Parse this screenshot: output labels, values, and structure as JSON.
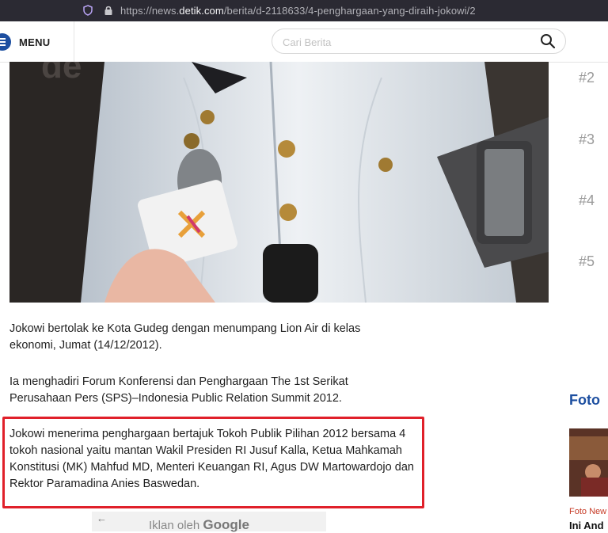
{
  "browser": {
    "url_prefix": "https://news.",
    "url_domain": "detik.com",
    "url_path": "/berita/d-2118633/4-penghargaan-yang-diraih-jokowi/2"
  },
  "header": {
    "menu_label": "MENU",
    "search_placeholder": "Cari Berita"
  },
  "article": {
    "paragraphs": [
      "Jokowi bertolak ke Kota Gudeg dengan menumpang Lion Air di kelas ekonomi, Jumat (14/12/2012).",
      "Ia menghadiri Forum Konferensi dan Penghargaan The 1st Serikat Perusahaan Pers (SPS)–Indonesia Public Relation Summit 2012.",
      "Jokowi menerima penghargaan bertajuk Tokoh Publik Pilihan 2012 bersama 4 tokoh nasional yaitu mantan Wakil Presiden RI Jusuf Kalla, Ketua Mahkamah Konstitusi (MK) Mahfud MD, Menteri Keuangan RI, Agus DW Martowardojo dan Rektor Paramadina Anies Baswedan."
    ]
  },
  "ad": {
    "back_glyph": "←",
    "label": "Iklan oleh",
    "brand": "Google"
  },
  "sidebar": {
    "ranks": [
      "#2",
      "#3",
      "#4",
      "#5"
    ],
    "foto_title": "Foto",
    "foto_category": "Foto New",
    "foto_headline": "Ini And"
  },
  "colors": {
    "brand_blue": "#1d4fa0",
    "highlight_red": "#e0202a"
  }
}
